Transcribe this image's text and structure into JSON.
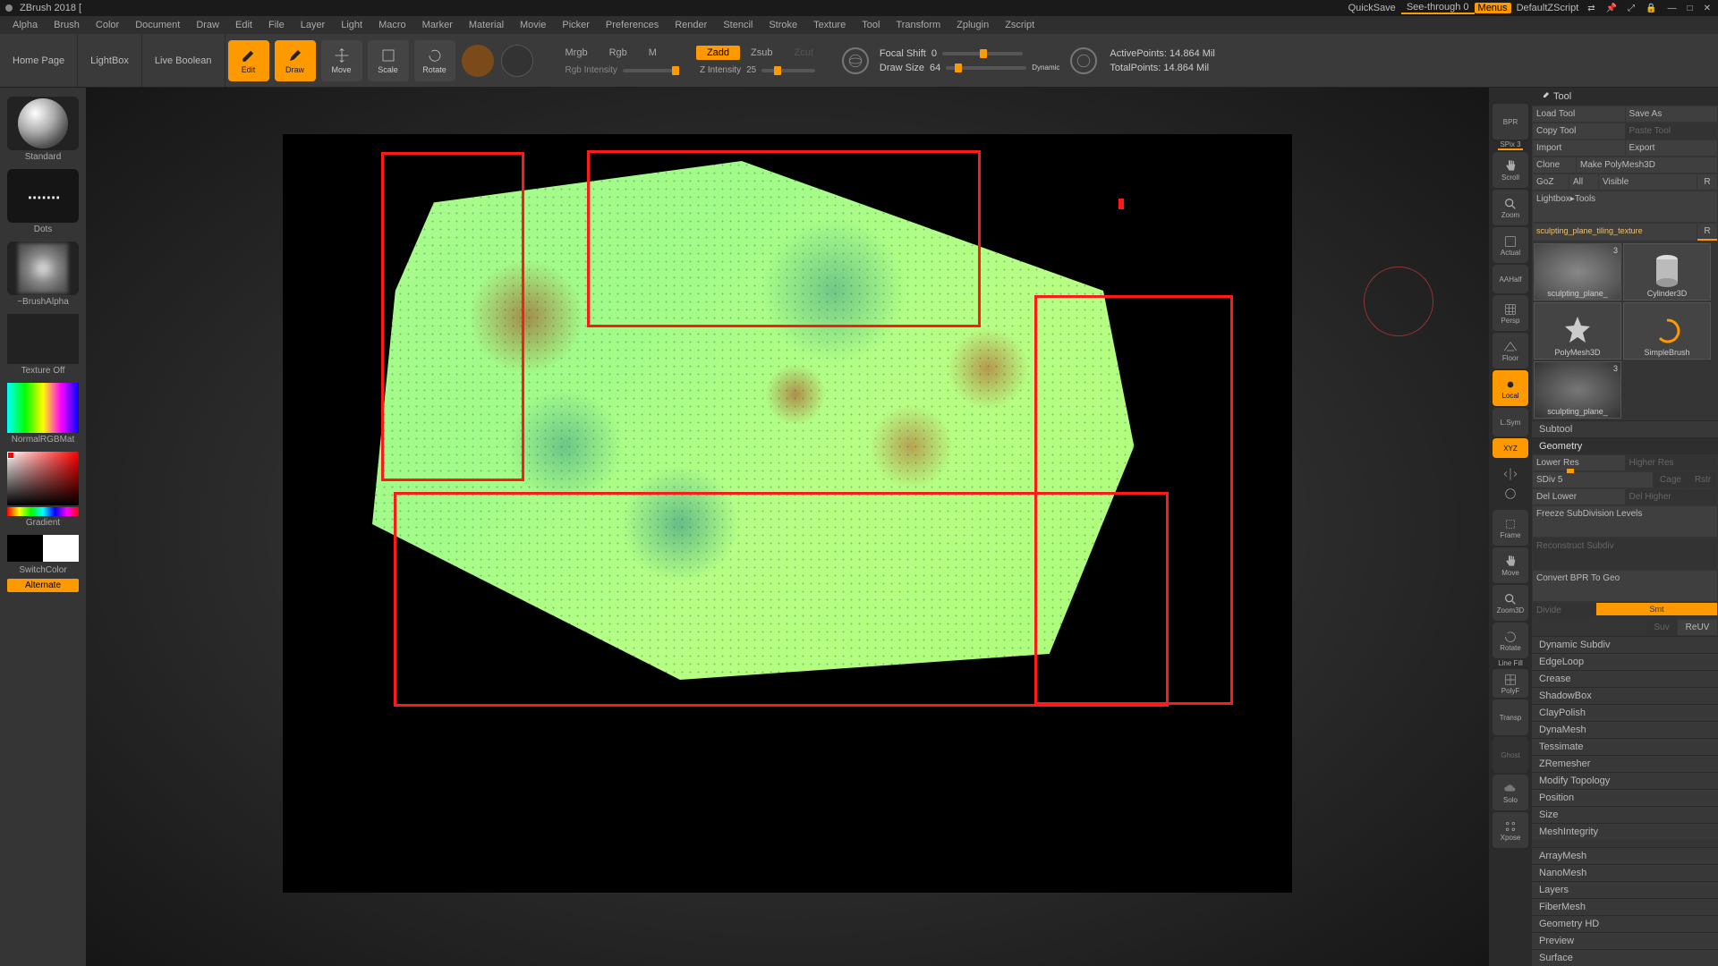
{
  "title": "ZBrush 2018 [",
  "titlebar": {
    "quicksave": "QuickSave",
    "seethrough": "See-through  0",
    "menus": "Menus",
    "script": "DefaultZScript"
  },
  "menus": [
    "Alpha",
    "Brush",
    "Color",
    "Document",
    "Draw",
    "Edit",
    "File",
    "Layer",
    "Light",
    "Macro",
    "Marker",
    "Material",
    "Movie",
    "Picker",
    "Preferences",
    "Render",
    "Stencil",
    "Stroke",
    "Texture",
    "Tool",
    "Transform",
    "Zplugin",
    "Zscript"
  ],
  "toolbar": {
    "home": "Home Page",
    "lightbox": "LightBox",
    "livebool": "Live Boolean",
    "edit": "Edit",
    "draw": "Draw",
    "move": "Move",
    "scale": "Scale",
    "rotate": "Rotate",
    "modes_rgb": [
      "Mrgb",
      "Rgb",
      "M"
    ],
    "rgb_intensity": "Rgb Intensity",
    "modes_z": [
      "Zadd",
      "Zsub",
      "Zcut"
    ],
    "z_intensity_lbl": "Z Intensity",
    "z_intensity_val": "25",
    "focal_lbl": "Focal Shift",
    "focal_val": "0",
    "draw_lbl": "Draw Size",
    "draw_val": "64",
    "dynamic": "Dynamic",
    "stats_active_lbl": "ActivePoints:",
    "stats_active_val": "14.864 Mil",
    "stats_total_lbl": "TotalPoints:",
    "stats_total_val": "14.864 Mil"
  },
  "left": {
    "brush": "Standard",
    "stroke": "Dots",
    "alpha": "~BrushAlpha",
    "texture": "Texture Off",
    "mat": "NormalRGBMat",
    "gradient": "Gradient",
    "switch": "SwitchColor",
    "alt": "Alternate"
  },
  "rstrip": [
    "BPR",
    "SPix 3",
    "Scroll",
    "Zoom",
    "Actual",
    "AAHalf",
    "Persp",
    "Floor",
    "Local",
    "L.Sym",
    "XYZ",
    "Frame",
    "Move",
    "Zoom3D",
    "Rotate",
    "Line Fill",
    "PolyF",
    "Transp",
    "Ghost",
    "Solo",
    "Xpose"
  ],
  "tool": {
    "title": "Tool",
    "row1": [
      "Load Tool",
      "Save As"
    ],
    "row2": [
      "Copy Tool",
      "Paste Tool"
    ],
    "row3": [
      "Import",
      "Export"
    ],
    "row4": [
      "Clone",
      "Make PolyMesh3D"
    ],
    "row5": [
      "GoZ",
      "All",
      "Visible",
      "R"
    ],
    "lightbox": "Lightbox▸Tools",
    "projname": "sculpting_plane_tiling_texture",
    "projR": "R",
    "tiles": [
      {
        "cap": "sculpting_plane_",
        "badge": "3"
      },
      {
        "cap": "Cylinder3D",
        "badge": ""
      },
      {
        "cap": "PolyMesh3D",
        "badge": ""
      },
      {
        "cap": "SimpleBrush",
        "badge": ""
      },
      {
        "cap": "sculpting_plane_",
        "badge": "3"
      }
    ],
    "subtool": "Subtool",
    "geometry": "Geometry",
    "lower": "Lower Res",
    "higher": "Higher Res",
    "sdiv_lbl": "SDiv",
    "sdiv_val": "5",
    "cage": "Cage",
    "rstr": "Rstr",
    "dell": "Del Lower",
    "delh": "Del Higher",
    "freeze": "Freeze SubDivision Levels",
    "recon": "Reconstruct Subdiv",
    "conv": "Convert BPR To Geo",
    "divide": "Divide",
    "smt": "Smt",
    "suv": "Suv",
    "reuv": "ReUV",
    "sections": [
      "Dynamic Subdiv",
      "EdgeLoop",
      "Crease",
      "ShadowBox",
      "ClayPolish",
      "DynaMesh",
      "Tessimate",
      "ZRemesher",
      "Modify Topology",
      "Position",
      "Size",
      "MeshIntegrity"
    ],
    "sections2": [
      "ArrayMesh",
      "NanoMesh",
      "Layers",
      "FiberMesh",
      "Geometry HD",
      "Preview",
      "Surface"
    ]
  }
}
